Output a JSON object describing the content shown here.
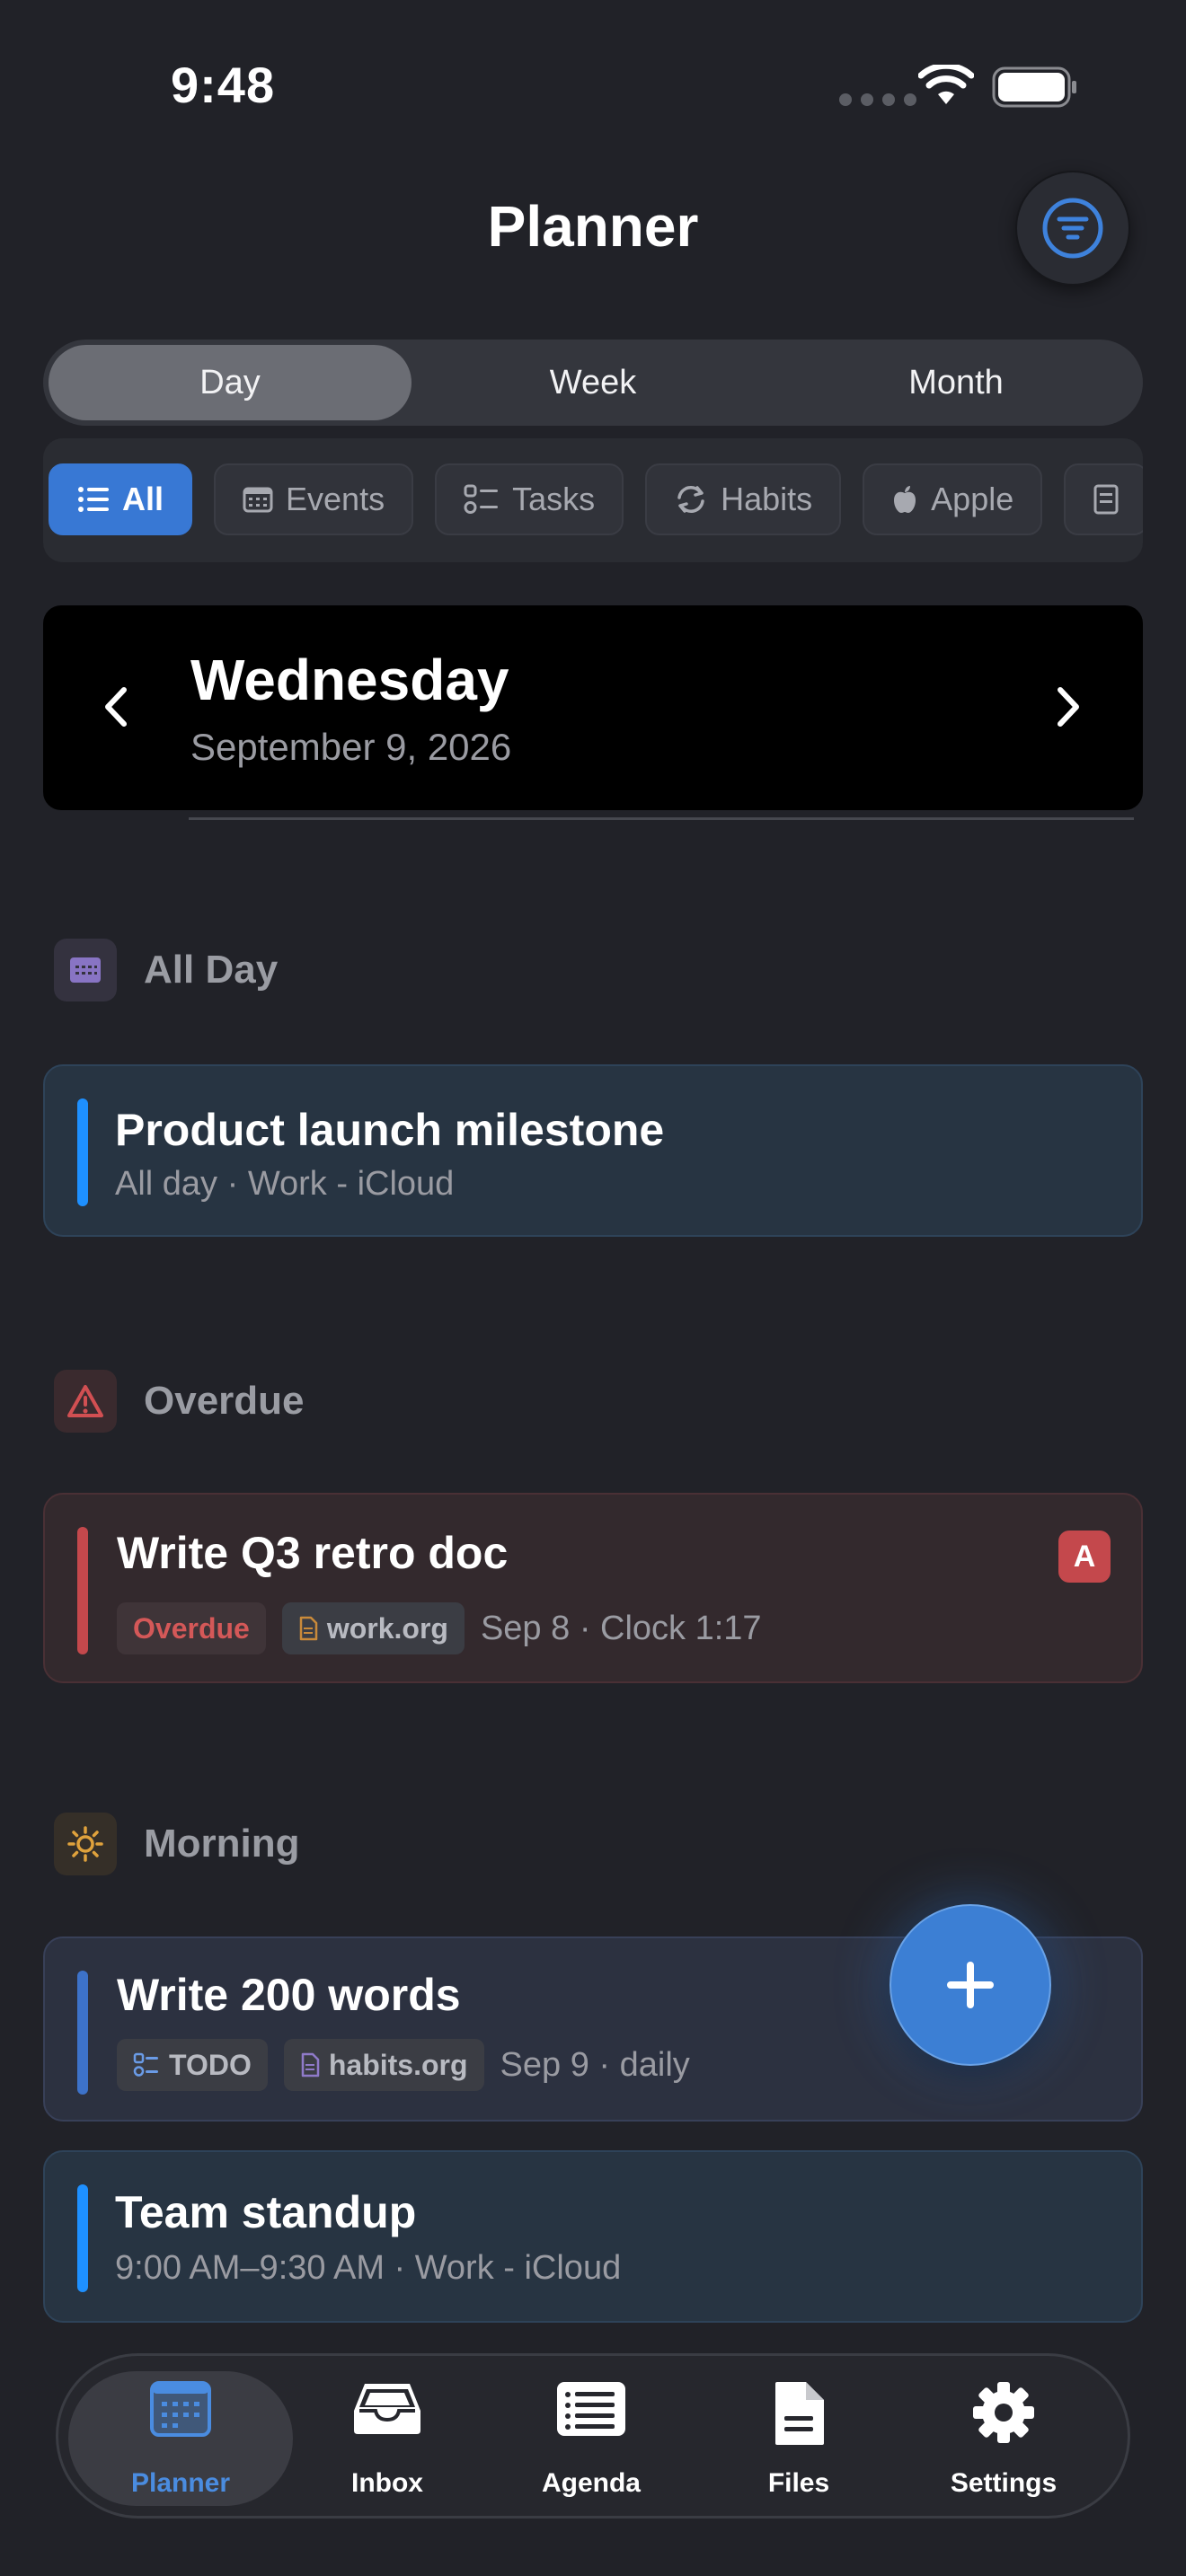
{
  "status_bar": {
    "time": "9:48"
  },
  "header": {
    "title": "Planner"
  },
  "view_modes": {
    "items": [
      {
        "label": "Day",
        "active": true
      },
      {
        "label": "Week"
      },
      {
        "label": "Month"
      }
    ]
  },
  "filters": {
    "items": [
      {
        "label": "All",
        "icon": "list-icon",
        "active": true
      },
      {
        "label": "Events",
        "icon": "calendar-icon"
      },
      {
        "label": "Tasks",
        "icon": "checklist-icon"
      },
      {
        "label": "Habits",
        "icon": "refresh-icon"
      },
      {
        "label": "Apple",
        "icon": "apple-icon"
      }
    ]
  },
  "date": {
    "weekday": "Wednesday",
    "full": "September 9, 2026"
  },
  "sections": {
    "all_day": {
      "title": "All Day",
      "items": [
        {
          "title": "Product launch milestone",
          "subtitle": "All day · Work - iCloud"
        }
      ]
    },
    "overdue": {
      "title": "Overdue",
      "items": [
        {
          "title": "Write Q3 retro doc",
          "tag": "Overdue",
          "file": "work.org",
          "meta": "Sep 8 · Clock 1:17",
          "priority": "A"
        }
      ]
    },
    "morning": {
      "title": "Morning",
      "items": [
        {
          "title": "Write 200 words",
          "tag": "TODO",
          "file": "habits.org",
          "meta": "Sep 9 · daily"
        },
        {
          "title": "Team standup",
          "subtitle": "9:00 AM–9:30 AM · Work - iCloud"
        }
      ]
    }
  },
  "tabbar": {
    "items": [
      {
        "label": "Planner",
        "icon": "calendar-grid-icon",
        "active": true
      },
      {
        "label": "Inbox",
        "icon": "inbox-tray-icon"
      },
      {
        "label": "Agenda",
        "icon": "agenda-list-icon"
      },
      {
        "label": "Files",
        "icon": "document-icon"
      },
      {
        "label": "Settings",
        "icon": "gear-icon"
      }
    ]
  },
  "colors": {
    "accent": "#3878d4",
    "event_bar": "#1e90ff",
    "overdue_red": "#c4484c",
    "todo_bar": "#3d72c9"
  }
}
